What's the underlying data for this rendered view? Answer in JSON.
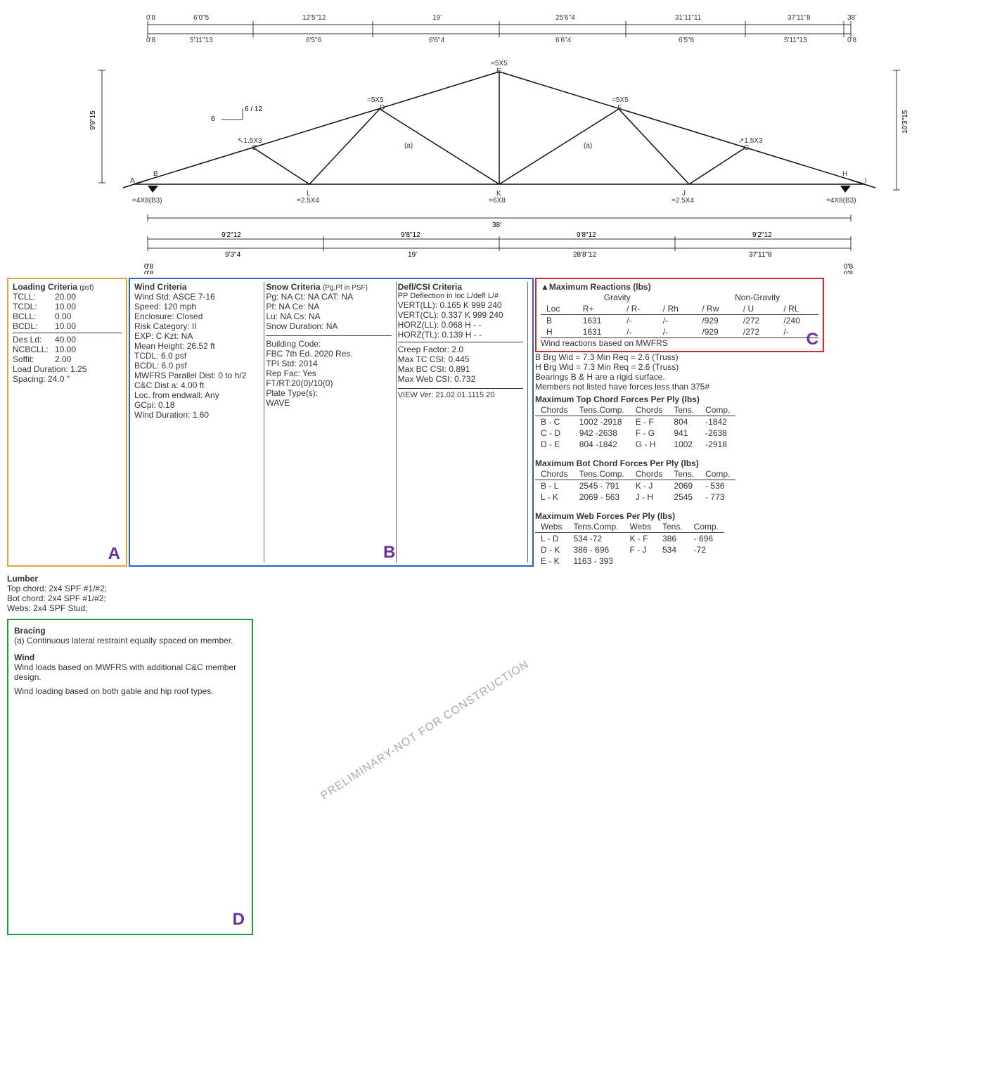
{
  "truss": {
    "dims_top": [
      "0'8",
      "6'0\"5",
      "12'5\"12",
      "19'",
      "25'6\"4",
      "31'11\"11",
      "37'11\"8",
      "38'"
    ],
    "dims_top2": [
      "0'8",
      "5'11\"13",
      "6'5\"6",
      "6'6\"4",
      "6'6\"4",
      "6'5\"6",
      "5'11\"13",
      "0'8"
    ],
    "overall": "38'",
    "left_v": "9'9\"15",
    "right_v": "10'3\"15",
    "dims_bot": [
      "9'2\"12",
      "9'8\"12",
      "9'8\"12",
      "9'2\"12"
    ],
    "dims_bot2": [
      "9'3\"4",
      "19'",
      "28'8\"12",
      "37'11\"8"
    ],
    "bot_end_l": "0'8",
    "bot_end_r": "0'8",
    "joints": {
      "A": "A",
      "B": "B",
      "C": "1.5X3 C",
      "D": "=5X5 D",
      "E": "=5X5 E",
      "F": "=5X5 F",
      "G": "1.5X3 G",
      "H": "H",
      "I": "I",
      "J": "=2.5X4",
      "K": "=6X8",
      "L": "=2.5X4"
    },
    "plates": {
      "left": "=4X8(B3)",
      "right": "=4X8(B3)"
    },
    "slope": "6 / 12",
    "a": "(a)"
  },
  "loading": {
    "title": "Loading Criteria",
    "psf": "(psf)",
    "rows": [
      [
        "TCLL:",
        "20.00"
      ],
      [
        "TCDL:",
        "10.00"
      ],
      [
        "BCLL:",
        "0.00"
      ],
      [
        "BCDL:",
        "10.00"
      ]
    ],
    "desld_k": "Des Ld:",
    "desld_v": "40.00",
    "rows2": [
      [
        "NCBCLL:",
        "10.00"
      ],
      [
        "Soffit:",
        "2.00"
      ],
      [
        "Load Duration:",
        "1.25"
      ],
      [
        "Spacing:",
        "24.0 \""
      ]
    ]
  },
  "wind": {
    "title": "Wind Criteria",
    "lines": [
      "Wind Std:   ASCE 7-16",
      "Speed:   120 mph",
      "Enclosure: Closed",
      "Risk Category: II",
      "EXP: C    Kzt: NA",
      "Mean Height: 26.52 ft",
      "TCDL: 6.0 psf",
      "BCDL: 6.0 psf",
      "MWFRS Parallel Dist: 0 to h/2",
      "C&C Dist a: 4.00 ft",
      "Loc. from endwall: Any",
      "          GCpi: 0.18",
      "Wind Duration: 1.60"
    ]
  },
  "snow": {
    "title": "Snow Criteria",
    "sub": "(Pg,Pf in PSF)",
    "lines": [
      "Pg: NA     Ct: NA     CAT: NA",
      "Pf: NA               Ce: NA",
      "Lu: NA     Cs: NA",
      "Snow Duration: NA"
    ]
  },
  "bcode": {
    "title": "Building Code:",
    "lines": [
      "FBC 7th Ed. 2020 Res.",
      "TPI Std:   2014",
      "Rep Fac: Yes",
      "FT/RT:20(0)/10(0)",
      "Plate Type(s):",
      "WAVE"
    ]
  },
  "defl": {
    "title": "Defl/CSI Criteria",
    "hdr": "PP Deflection in   loc L/defl  L/#",
    "rows": [
      [
        "VERT(LL):",
        "0.165",
        "K",
        "999",
        "240"
      ],
      [
        "VERT(CL):",
        "0.337",
        "K",
        "999",
        "240"
      ],
      [
        "HORZ(LL):",
        "0.068",
        "H",
        "-",
        "-"
      ],
      [
        "HORZ(TL):",
        "0.139",
        "H",
        "-",
        "-"
      ]
    ],
    "lines": [
      "Creep Factor: 2.0",
      "Max TC CSI:     0.445",
      "Max BC CSI:     0.891",
      "Max Web CSI:   0.732"
    ],
    "view": "VIEW Ver: 21.02.01.1115.20"
  },
  "react": {
    "title": "▲Maximum Reactions (lbs)",
    "grav": "Gravity",
    "ngrav": "Non-Gravity",
    "hdr": [
      "Loc",
      "R+",
      "/ R-",
      "/ Rh",
      "/ Rw",
      "/ U",
      "/ RL"
    ],
    "rows": [
      [
        "B",
        "1631",
        "/-",
        "/-",
        "/929",
        "/272",
        "/240"
      ],
      [
        "H",
        "1631",
        "/-",
        "/-",
        "/929",
        "/272",
        "/-"
      ]
    ],
    "note": "Wind reactions based on MWFRS",
    "brg": [
      "B    Brg Wid = 7.3     Min Req =  2.6 (Truss)",
      "H    Brg Wid = 7.3     Min Req =  2.6 (Truss)",
      "Bearings B & H are a rigid surface.",
      "Members not listed have forces less than 375#"
    ]
  },
  "topchord": {
    "title": "Maximum Top Chord Forces Per Ply (lbs)",
    "hdr": [
      "Chords",
      "Tens.Comp.",
      "Chords",
      "Tens.",
      "Comp."
    ],
    "rows": [
      [
        "B - C",
        "1002",
        "-2918",
        "E - F",
        "804",
        "-1842"
      ],
      [
        "C - D",
        "942",
        "-2638",
        "F - G",
        "941",
        "-2638"
      ],
      [
        "D - E",
        "804",
        "-1842",
        "G - H",
        "1002",
        "-2918"
      ]
    ]
  },
  "botchord": {
    "title": "Maximum Bot Chord Forces Per Ply (lbs)",
    "hdr": [
      "Chords",
      "Tens.Comp.",
      "Chords",
      "Tens.",
      "Comp."
    ],
    "rows": [
      [
        "B - L",
        "2545",
        "- 791",
        "K - J",
        "2069",
        "- 536"
      ],
      [
        "L - K",
        "2069",
        "- 563",
        "J - H",
        "2545",
        "- 773"
      ]
    ]
  },
  "web": {
    "title": "Maximum Web Forces Per Ply (lbs)",
    "hdr": [
      "Webs",
      "Tens.Comp.",
      "Webs",
      "Tens.",
      "Comp."
    ],
    "rows": [
      [
        "L - D",
        "534",
        "-72",
        "K - F",
        "386",
        "- 696"
      ],
      [
        "D - K",
        "386",
        "- 696",
        "F - J",
        "534",
        "-72"
      ],
      [
        "E - K",
        "1163",
        "- 393",
        "",
        "",
        ""
      ]
    ]
  },
  "lumber": {
    "title": "Lumber",
    "lines": [
      "Top chord: 2x4 SPF #1/#2;",
      "Bot chord: 2x4 SPF #1/#2;",
      "Webs: 2x4 SPF Stud;"
    ]
  },
  "bracing": {
    "title": "Bracing",
    "line": "(a) Continuous lateral restraint equally spaced on member."
  },
  "windnote": {
    "title": "Wind",
    "lines": [
      "Wind loads based on MWFRS with additional C&C member design.",
      "Wind loading based on both gable and hip roof types."
    ]
  },
  "letters": {
    "A": "A",
    "B": "B",
    "C": "C",
    "D": "D"
  },
  "watermark": "PRELIMINARY-NOT FOR CONSTRUCTION"
}
